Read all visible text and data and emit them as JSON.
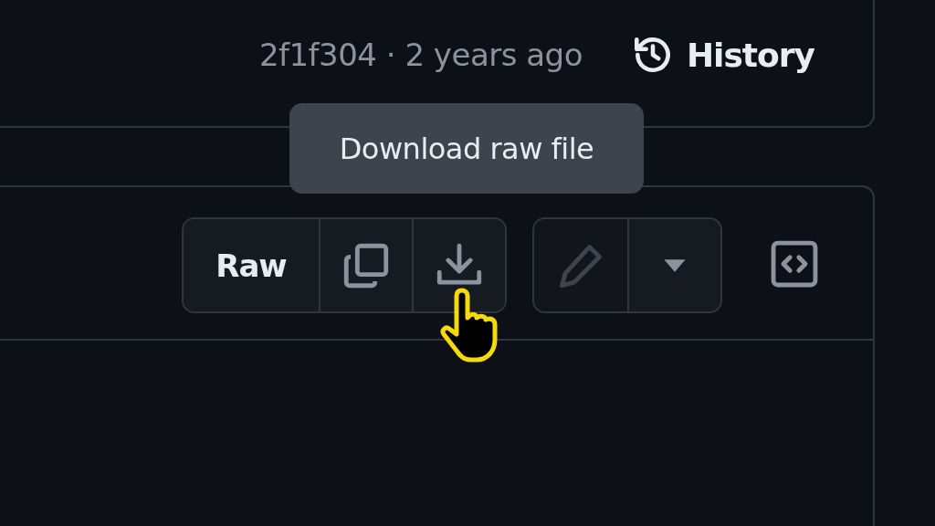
{
  "commit": {
    "text": "2f1f304 · 2 years ago"
  },
  "history_button": {
    "label": "History"
  },
  "tooltip": {
    "text": "Download raw file"
  },
  "file_actions": [
    {
      "kind": "raw",
      "label": "Raw",
      "disabled": false
    },
    {
      "kind": "copy",
      "disabled": false
    },
    {
      "kind": "download",
      "disabled": false
    }
  ],
  "edit_actions": [
    {
      "kind": "edit",
      "disabled": true
    },
    {
      "kind": "dropdown",
      "disabled": false
    }
  ],
  "symbols_button": {
    "kind": "symbols"
  }
}
